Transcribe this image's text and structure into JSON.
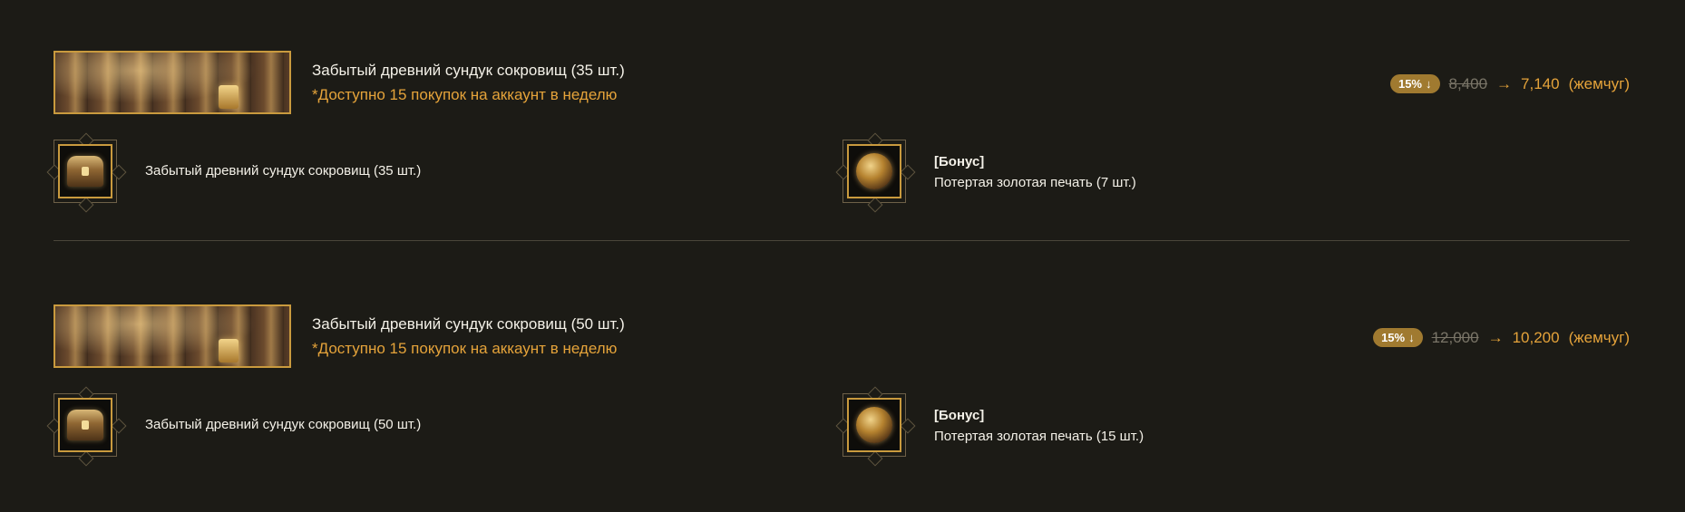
{
  "products": [
    {
      "title": "Забытый древний сундук сокровищ (35 шт.)",
      "limit": "*Доступно 15 покупок на аккаунт в неделю",
      "discount": "15%",
      "discount_icon": "down-arrow-icon",
      "old_price": "8,400",
      "arrow": "→",
      "new_price": "7,140",
      "currency": "(жемчуг)",
      "item_name": "Забытый древний сундук сокровищ (35 шт.)",
      "bonus_label": "[Бонус]",
      "bonus_name": "Потертая золотая печать (7 шт.)"
    },
    {
      "title": "Забытый древний сундук сокровищ (50 шт.)",
      "limit": "*Доступно 15 покупок на аккаунт в неделю",
      "discount": "15%",
      "discount_icon": "down-arrow-icon",
      "old_price": "12,000",
      "arrow": "→",
      "new_price": "10,200",
      "currency": "(жемчуг)",
      "item_name": "Забытый древний сундук сокровищ (50 шт.)",
      "bonus_label": "[Бонус]",
      "bonus_name": "Потертая золотая печать (15 шт.)"
    }
  ],
  "colors": {
    "background": "#1c1b16",
    "accent": "#e5a33a",
    "badge": "#a07a30",
    "frame": "#c99a3e"
  }
}
